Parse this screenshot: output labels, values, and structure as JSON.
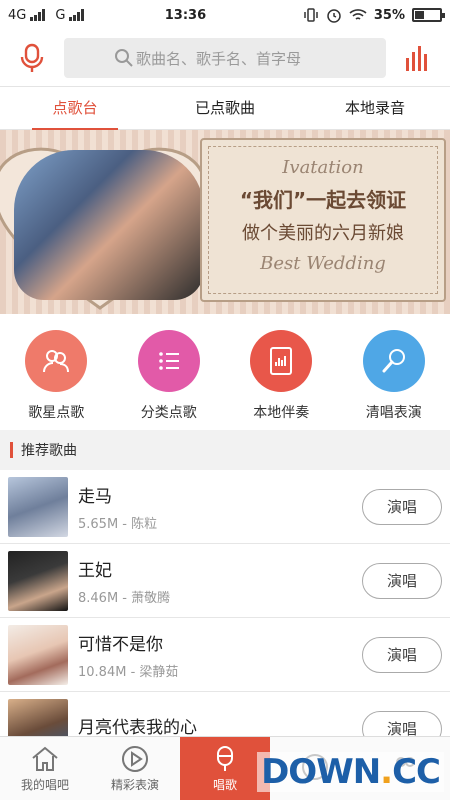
{
  "status_bar": {
    "network1": "4G",
    "network2": "G",
    "time": "13:36",
    "battery": "35%"
  },
  "search": {
    "placeholder": "歌曲名、歌手名、首字母"
  },
  "tabs": [
    {
      "label": "点歌台",
      "active": true
    },
    {
      "label": "已点歌曲",
      "active": false
    },
    {
      "label": "本地录音",
      "active": false
    }
  ],
  "banner": {
    "line_top": "Ivatation",
    "line_main": "“我们”一起去领证",
    "line_sub": "做个美丽的六月新娘",
    "line_bottom": "Best Wedding"
  },
  "quick_actions": [
    {
      "label": "歌星点歌",
      "color": "#ef7a6a",
      "icon": "singer-icon"
    },
    {
      "label": "分类点歌",
      "color": "#e25aa8",
      "icon": "list-icon"
    },
    {
      "label": "本地伴奏",
      "color": "#e8574a",
      "icon": "audio-file-icon"
    },
    {
      "label": "清唱表演",
      "color": "#4fa7e6",
      "icon": "microphone-icon"
    }
  ],
  "section_title": "推荐歌曲",
  "songs": [
    {
      "title": "走马",
      "meta": "5.65M - 陈粒",
      "button": "演唱"
    },
    {
      "title": "王妃",
      "meta": "8.46M - 萧敬腾",
      "button": "演唱"
    },
    {
      "title": "可惜不是你",
      "meta": "10.84M - 梁静茹",
      "button": "演唱"
    },
    {
      "title": "月亮代表我的心",
      "meta": "",
      "button": "演唱"
    }
  ],
  "bottom_nav": [
    {
      "label": "我的唱吧",
      "active": false
    },
    {
      "label": "精彩表演",
      "active": false
    },
    {
      "label": "唱歌",
      "active": true
    },
    {
      "label": "",
      "active": false
    },
    {
      "label": "",
      "active": false
    }
  ],
  "watermark": {
    "text": "DOWN",
    "dot": ".",
    "suffix": "CC"
  }
}
